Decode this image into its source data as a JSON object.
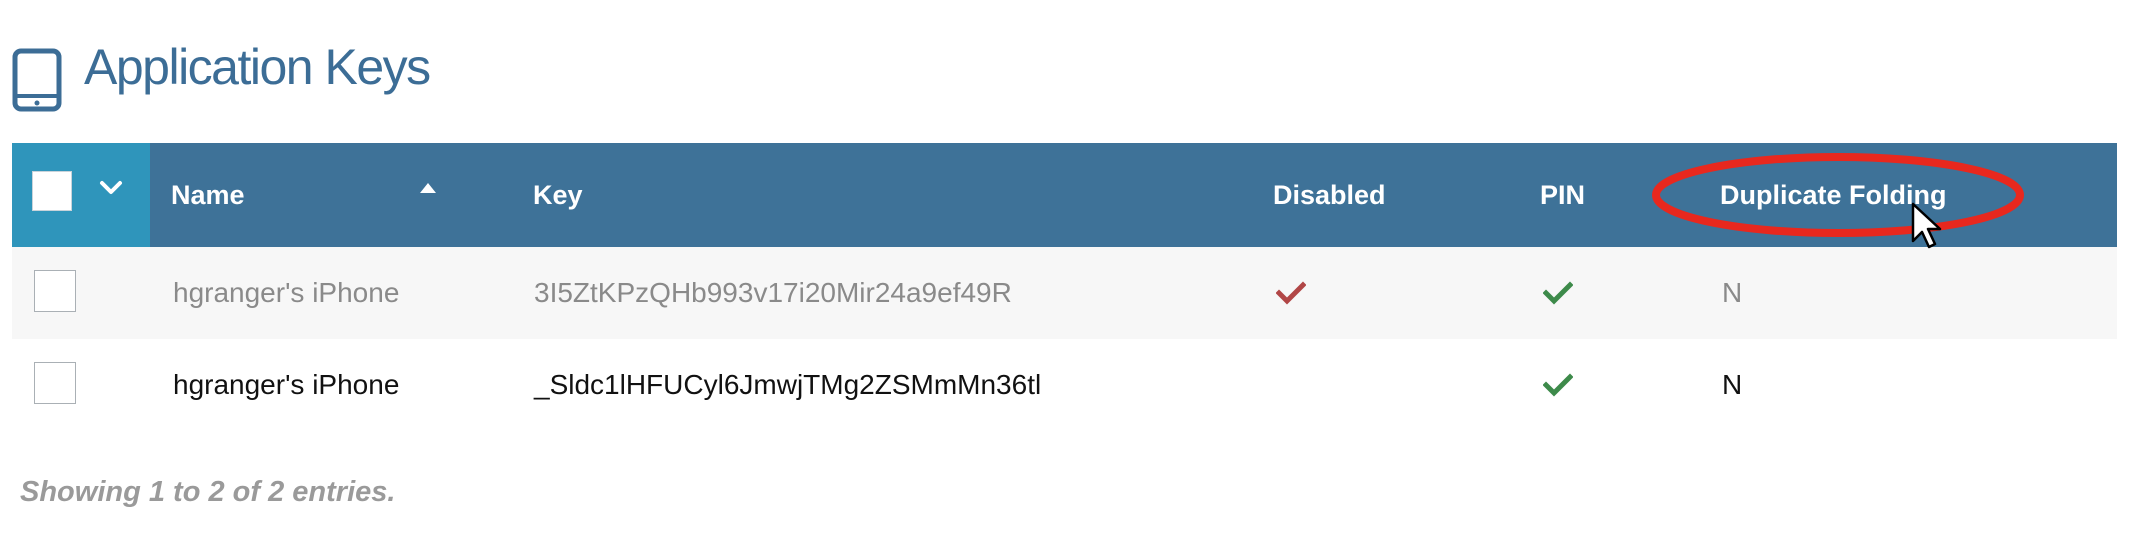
{
  "page": {
    "title": "Application Keys",
    "icon": "tablet-icon"
  },
  "table": {
    "columns": {
      "name": "Name",
      "key": "Key",
      "disabled": "Disabled",
      "pin": "PIN",
      "duplicate_folding": "Duplicate Folding"
    },
    "sort": {
      "column": "Name",
      "direction": "ascending"
    },
    "rows": [
      {
        "name": "hgranger's iPhone",
        "key": "3I5ZtKPzQHb993v17i20Mir24a9ef49R",
        "disabled": true,
        "pin": true,
        "duplicate_folding": "N",
        "style": "muted"
      },
      {
        "name": "hgranger's iPhone",
        "key": "_Sldc1lHFUCyl6JmwjTMg2ZSMmMn36tl",
        "disabled": false,
        "pin": true,
        "duplicate_folding": "N",
        "style": "normal"
      }
    ]
  },
  "footer": {
    "info": "Showing 1 to 2 of 2 entries."
  },
  "annotation": {
    "highlighted_column": "Duplicate Folding",
    "color": "#e8281e"
  },
  "colors": {
    "header_bg": "#3e7298",
    "select_header_bg": "#2f95bb",
    "title": "#3c6d96",
    "check_red": "#b14646",
    "check_green": "#3d8a4a"
  }
}
